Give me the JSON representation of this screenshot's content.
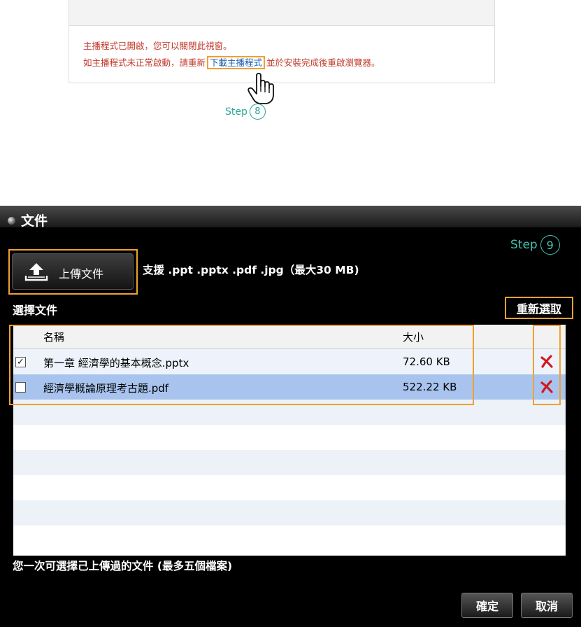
{
  "notice": {
    "line1": "主播程式已開啟，您可以關閉此視窗。",
    "line2_before": "如主播程式未正常啟動，請重新",
    "link_text": "下載主播程式",
    "line2_after": "並於安裝完成後重啟瀏覽器。",
    "hand_icon": "pointer-hand-icon"
  },
  "step8": {
    "label": "Step",
    "number": "8"
  },
  "dialog": {
    "title": "文件",
    "step9": {
      "label": "Step",
      "number": "9"
    },
    "upload_button_label": "上傳文件",
    "upload_icon": "upload-icon",
    "support_text": "支援 .ppt .pptx .pdf .jpg（最大30 MB)",
    "select_label": "選擇文件",
    "reselect_link": "重新選取",
    "table": {
      "headers": {
        "name": "名稱",
        "size": "大小"
      },
      "rows": [
        {
          "checked": true,
          "name": "第一章 經濟學的基本概念.pptx",
          "size": "72.60 KB",
          "delete_icon": "delete-x-icon"
        },
        {
          "checked": false,
          "name": "經濟學概論原理考古題.pdf",
          "size": "522.22 KB",
          "delete_icon": "delete-x-icon"
        }
      ]
    },
    "footnote": "您一次可選擇己上傳過的文件 (最多五個檔案)",
    "ok_label": "確定",
    "cancel_label": "取消"
  },
  "colors": {
    "highlight_outline": "#f0a030",
    "step_teal": "#2aa596",
    "notice_red": "#c0392b",
    "link_blue": "#1c5fb0",
    "selected_row": "#a8c4ee",
    "delete_red": "#d0181c"
  }
}
